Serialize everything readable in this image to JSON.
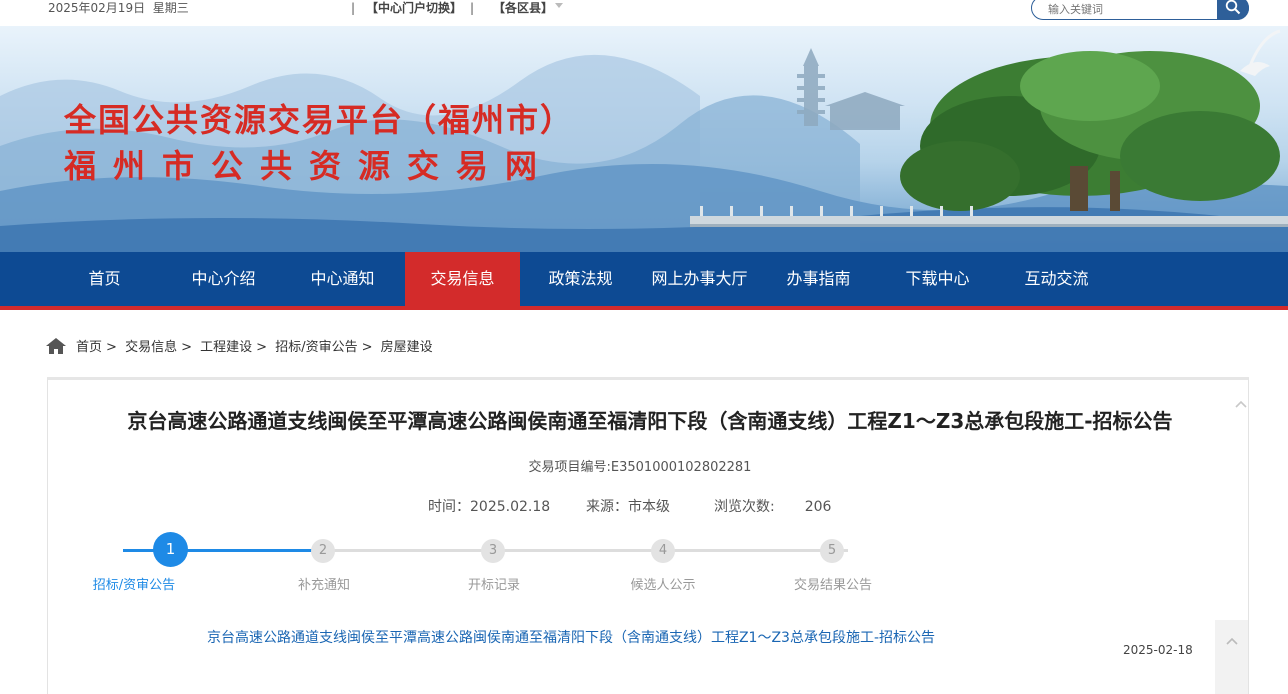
{
  "topbar": {
    "date": "2025年02月19日",
    "weekday": "星期三",
    "portal_switch": "【中心门户切换】",
    "district": "【各区县】",
    "search_placeholder": "输入关键词"
  },
  "banner": {
    "title_line1": "全国公共资源交易平台（福州市）",
    "title_line2": "福州市公共资源交易网"
  },
  "nav": {
    "items": [
      "首页",
      "中心介绍",
      "中心通知",
      "交易信息",
      "政策法规",
      "网上办事大厅",
      "办事指南",
      "下载中心",
      "互动交流"
    ],
    "active_index": 3
  },
  "breadcrumb": {
    "items": [
      "首页",
      "交易信息",
      "工程建设",
      "招标/资审公告",
      "房屋建设"
    ],
    "separator": ">"
  },
  "article": {
    "title": "京台高速公路通道支线闽侯至平潭高速公路闽侯南通至福清阳下段（含南通支线）工程Z1～Z3总承包段施工-招标公告",
    "project_no_label": "交易项目编号:",
    "project_no": "E3501000102802281",
    "time_label": "时间：",
    "time_value": "2025.02.18",
    "source_label": "来源：",
    "source_value": "市本级",
    "views_label": "浏览次数:",
    "views_value": "206"
  },
  "steps": [
    {
      "num": "1",
      "label": "招标/资审公告",
      "active": true
    },
    {
      "num": "2",
      "label": "补充通知",
      "active": false
    },
    {
      "num": "3",
      "label": "开标记录",
      "active": false
    },
    {
      "num": "4",
      "label": "候选人公示",
      "active": false
    },
    {
      "num": "5",
      "label": "交易结果公告",
      "active": false
    }
  ],
  "list": {
    "link_text": "京台高速公路通道支线闽侯至平潭高速公路闽侯南通至福清阳下段（含南通支线）工程Z1～Z3总承包段施工-招标公告",
    "date": "2025-02-18"
  },
  "colors": {
    "nav_bg": "#0d4a93",
    "nav_active": "#d32b2b",
    "banner_title": "#d62b24",
    "step_active": "#1e8ae6",
    "link": "#1a66b3"
  }
}
